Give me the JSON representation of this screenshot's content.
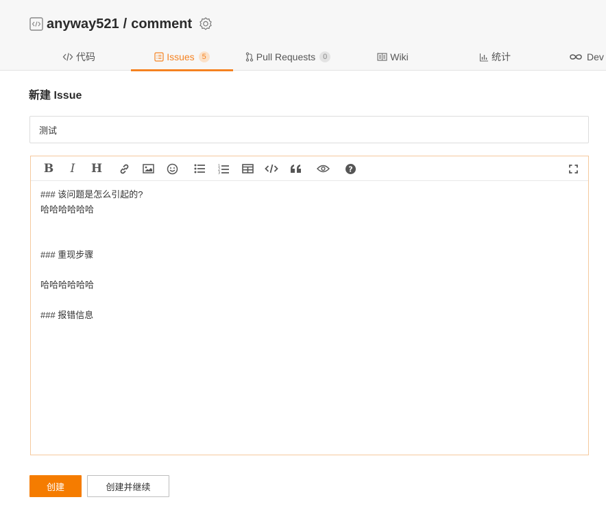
{
  "repo": {
    "owner": "anyway521",
    "separator": "/",
    "name": "comment"
  },
  "tabs": [
    {
      "label": "代码",
      "icon": "code-icon"
    },
    {
      "label": "Issues",
      "count": "5",
      "icon": "issues-icon",
      "active": true
    },
    {
      "label": "Pull Requests",
      "count": "0",
      "icon": "pull-request-icon"
    },
    {
      "label": "Wiki",
      "icon": "wiki-icon"
    },
    {
      "label": "统计",
      "icon": "chart-icon"
    },
    {
      "label": "Dev",
      "icon": "infinity-icon"
    }
  ],
  "page": {
    "heading": "新建 Issue"
  },
  "form": {
    "title_value": "测试",
    "body_text": "### 该问题是怎么引起的?\n哈哈哈哈哈哈\n\n\n### 重现步骤\n\n哈哈哈哈哈哈\n\n### 报错信息",
    "toolbar": [
      "bold",
      "italic",
      "heading",
      "link",
      "image",
      "emoji",
      "unordered-list",
      "ordered-list",
      "table",
      "code",
      "quote",
      "preview",
      "help",
      "fullscreen"
    ]
  },
  "actions": {
    "create_label": "创建",
    "create_continue_label": "创建并继续"
  },
  "colors": {
    "accent": "#f58220",
    "button": "#f57c00",
    "editor_border": "#f5c89c"
  }
}
